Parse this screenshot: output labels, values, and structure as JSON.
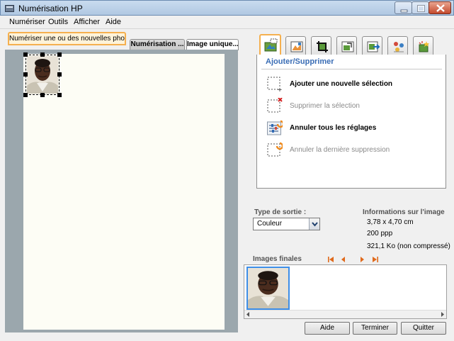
{
  "window": {
    "title": "Numérisation HP"
  },
  "menu": {
    "items": [
      "Numériser",
      "Outils",
      "Afficher",
      "Aide"
    ]
  },
  "tabs": {
    "scan_new": "Numériser une ou des nouvelles photos",
    "scan_preview": "Numérisation ...",
    "single_image": "Image unique..."
  },
  "tool_tabs": [
    "add-remove",
    "image-adjust",
    "crop",
    "resize",
    "export",
    "color-settings",
    "enhance"
  ],
  "panel": {
    "title": "Ajouter/Supprimer",
    "actions": [
      {
        "label": "Ajouter une nouvelle sélection",
        "enabled": true,
        "icon": "add-selection-icon"
      },
      {
        "label": "Supprimer la sélection",
        "enabled": false,
        "icon": "delete-selection-icon"
      },
      {
        "label": "Annuler tous les réglages",
        "enabled": true,
        "icon": "reset-settings-icon"
      },
      {
        "label": "Annuler la dernière suppression",
        "enabled": false,
        "icon": "undo-delete-icon"
      }
    ]
  },
  "output": {
    "type_label": "Type de sortie :",
    "type_value": "Couleur"
  },
  "image_info": {
    "heading": "Informations sur l'image",
    "dimensions": "3,78 x 4,70 cm",
    "resolution": "200 ppp",
    "size": "321,1 Ko (non compressé)"
  },
  "final_images": {
    "label": "Images finales"
  },
  "buttons": {
    "help": "Aide",
    "finish": "Terminer",
    "quit": "Quitter"
  },
  "colors": {
    "accent_orange": "#f5b04f",
    "panel_title_blue": "#3a6db5",
    "nav_orange": "#e06a1c",
    "scan_bed": "#9ba7ad"
  }
}
